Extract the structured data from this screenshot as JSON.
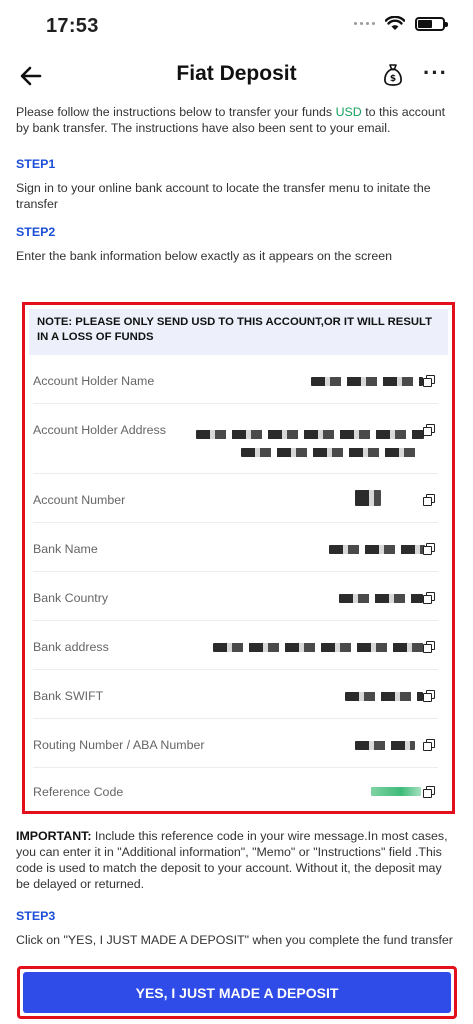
{
  "status_bar": {
    "time": "17:53"
  },
  "header": {
    "title": "Fiat Deposit"
  },
  "intro": {
    "before": "Please follow the instructions below to transfer your funds ",
    "currency": "USD",
    "after": " to this account by bank transfer. The instructions have also been sent to your email."
  },
  "steps": [
    {
      "label": "STEP1",
      "text": "Sign in to your online bank account to locate the transfer menu to initate the transfer"
    },
    {
      "label": "STEP2",
      "text": "Enter the bank information below exactly as it appears on the screen"
    },
    {
      "label": "STEP3",
      "text": "Click on \"YES, I JUST MADE A DEPOSIT\" when you complete the fund transfer"
    }
  ],
  "note": "NOTE: PLEASE ONLY SEND USD TO THIS ACCOUNT,OR IT WILL RESULT IN A LOSS OF FUNDS",
  "fields": [
    {
      "label": "Account Holder Name"
    },
    {
      "label": "Account Holder Address"
    },
    {
      "label": "Account Number"
    },
    {
      "label": "Bank Name"
    },
    {
      "label": "Bank Country"
    },
    {
      "label": "Bank address"
    },
    {
      "label": "Bank SWIFT"
    },
    {
      "label": "Routing Number / ABA Number"
    },
    {
      "label": "Reference Code"
    }
  ],
  "important": {
    "lead": "IMPORTANT:",
    "text": " Include this reference code in your wire message.In most cases, you can enter it in \"Additional information\", \"Memo\" or \"Instructions\" field .This code is used to match the deposit to your account. Without it, the deposit may be delayed or returned."
  },
  "cta": {
    "label": "YES, I JUST MADE A DEPOSIT"
  },
  "colors": {
    "accent_blue": "#2f4be8",
    "step_blue": "#1d4fd8",
    "usd_green": "#19a15f",
    "highlight_red": "#e3101c"
  }
}
